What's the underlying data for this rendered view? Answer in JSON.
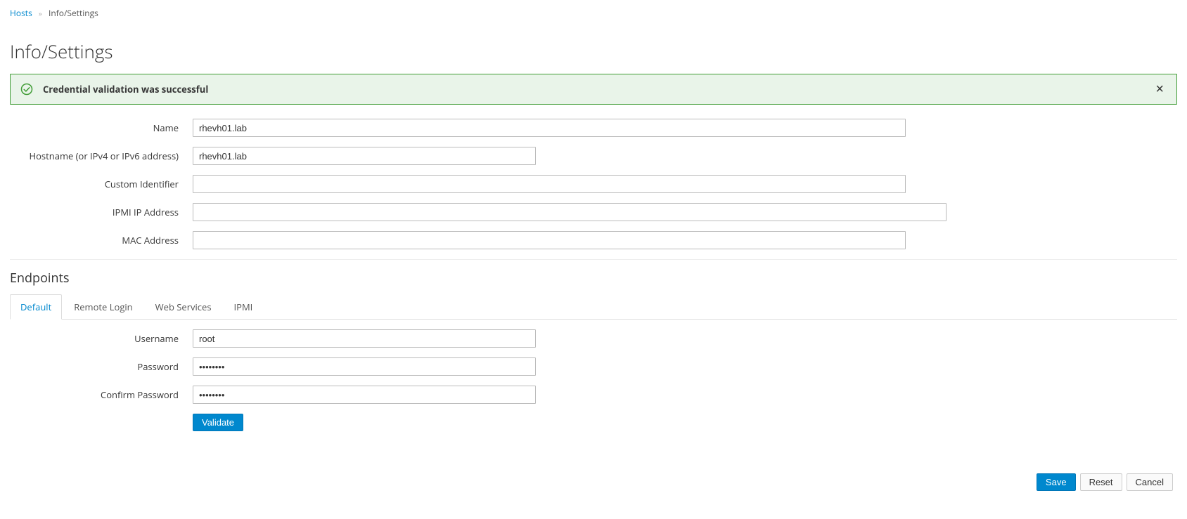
{
  "breadcrumb": {
    "root": "Hosts",
    "current": "Info/Settings"
  },
  "page_title": "Info/Settings",
  "alert": {
    "message": "Credential validation was successful"
  },
  "form": {
    "name_label": "Name",
    "name_value": "rhevh01.lab",
    "hostname_label": "Hostname (or IPv4 or IPv6 address)",
    "hostname_value": "rhevh01.lab",
    "custom_id_label": "Custom Identifier",
    "custom_id_value": "",
    "ipmi_ip_label": "IPMI IP Address",
    "ipmi_ip_value": "",
    "mac_label": "MAC Address",
    "mac_value": ""
  },
  "endpoints": {
    "section_title": "Endpoints",
    "tabs": {
      "default": "Default",
      "remote_login": "Remote Login",
      "web_services": "Web Services",
      "ipmi": "IPMI"
    },
    "username_label": "Username",
    "username_value": "root",
    "password_label": "Password",
    "password_value": "••••••••",
    "confirm_label": "Confirm Password",
    "confirm_value": "••••••••",
    "validate_label": "Validate"
  },
  "footer": {
    "save": "Save",
    "reset": "Reset",
    "cancel": "Cancel"
  }
}
